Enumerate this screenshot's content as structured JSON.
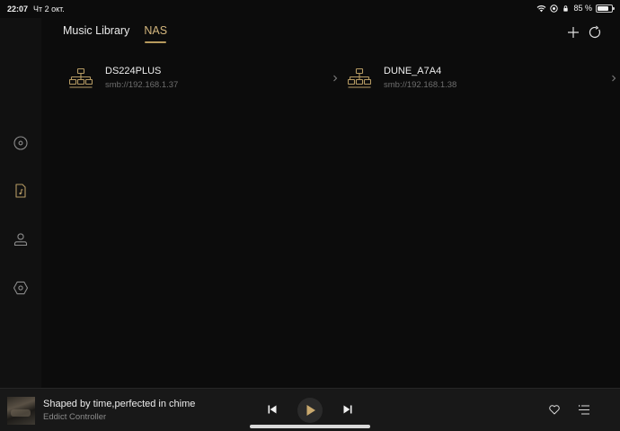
{
  "status_bar": {
    "time": "22:07",
    "date": "Чт 2 окт.",
    "battery": "85 %",
    "battery_level_fraction": 0.85
  },
  "sidebar": {
    "items": [
      {
        "icon": "disc-icon"
      },
      {
        "icon": "music-file-icon"
      },
      {
        "icon": "user-icon"
      },
      {
        "icon": "hexagon-settings-icon"
      }
    ]
  },
  "header": {
    "tabs": [
      {
        "label": "Music Library",
        "active": false
      },
      {
        "label": "NAS",
        "active": true
      }
    ],
    "actions": [
      {
        "icon": "plus-icon"
      },
      {
        "icon": "refresh-icon"
      }
    ]
  },
  "nas_devices": [
    {
      "name": "DS224PLUS",
      "address": "smb://192.168.1.37"
    },
    {
      "name": "DUNE_A7A4",
      "address": "smb://192.168.1.38"
    }
  ],
  "player": {
    "title": "Shaped by time,perfected in chime",
    "artist": "Eddict Controller",
    "accent_color": "#c9a96e"
  },
  "colors": {
    "accent": "#d5b77e",
    "background": "#0c0c0c",
    "sidebar": "#111111",
    "player": "#181818"
  }
}
